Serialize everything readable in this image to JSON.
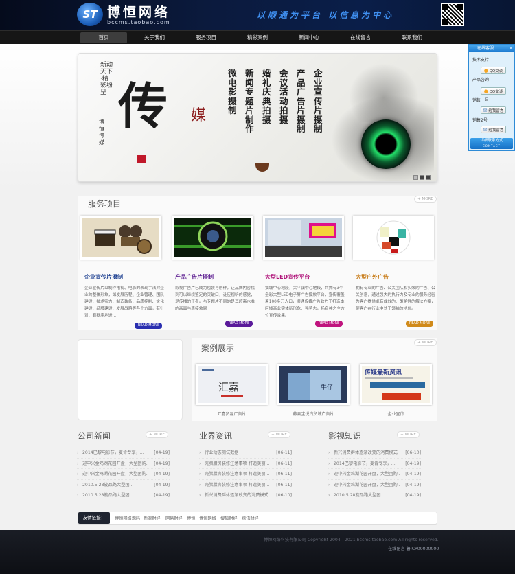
{
  "header": {
    "logo_mark": "ST",
    "logo_text": "博恒网络",
    "logo_domain": "bccms.taobao.com",
    "slogan": "以顺通为平台  以信息为中心"
  },
  "nav": [
    "首页",
    "关于我们",
    "服务项目",
    "精彩案例",
    "新闻中心",
    "在线留言",
    "联系我们"
  ],
  "banner": {
    "calligraphy_1": "新动天下·精彩纷呈",
    "calligraphy_2": "博恒传媒",
    "big_char": "传",
    "media_char": "媒",
    "columns": [
      "微电影摄制",
      "新闻专题片制作",
      "婚礼庆典拍摄",
      "会议活动拍摄",
      "产品广告片摄制",
      "企业宣传片摄制"
    ]
  },
  "qq": {
    "title": "在线客服",
    "close": "×",
    "groups": [
      {
        "label": "技术支持",
        "button": "QQ交谈"
      },
      {
        "label": "产品咨询",
        "button": "QQ交谈"
      },
      {
        "label": "销售一号",
        "button": "给我留言"
      },
      {
        "label": "销售2号",
        "button": "给我留言"
      }
    ],
    "footer": "详细联系方式",
    "footer_sub": "CONTACT"
  },
  "services": {
    "title": "服务项目",
    "more": "+ MORE",
    "items": [
      {
        "title": "企业宣传片摄制",
        "color": "#1a3d8f",
        "text": "企业宣传片以制作电视、电影的表现手法对企业的整体形象，如发展历程、企业管理、团队建设、技术实力、制造装备、品质控制、文化建设、品牌建设、发展战略等各个方面，有针对、有秩序地进...",
        "more": "READ MORE",
        "btn_color": "#2a2fb0"
      },
      {
        "title": "产品广告片摄制",
        "color": "#5a1a8f",
        "text": "影视广告片已成为包装与创作，让品牌内容找到可以继续鉴定的突破口，让应视听的感觉，是传播的王者。与专题片不同的是其超高水准的画面与表接效果",
        "more": "READ MORE",
        "btn_color": "#5a1a9a"
      },
      {
        "title": "大型LED宣传平台",
        "color": "#b0147a",
        "text": "猫城中心地段，太平镇中心地段，共拥有3个全彩大型LED电子屏广告投放平台，宣传覆盖着100多万人口，顺通传媒广告致力于打造本区域商业实体新形象、强势志，扬名神之全方位宣传效果。",
        "more": "READ MORE",
        "btn_color": "#c0147e"
      },
      {
        "title": "大型户外广告",
        "color": "#c77a14",
        "text": "拥有专业的广告、公关团队和实效的广告、公关创意，通过强大的执行力及专业的服务经验为客户提供卓有成效的、策略性的解决方案，使客户在行业中处于领袖的地位。",
        "more": "READ MORE",
        "btn_color": "#d08a1a"
      }
    ]
  },
  "cases": {
    "title": "案例展示",
    "more": "+ MORE",
    "items": [
      {
        "caption": "汇嘉贸易广告片",
        "img_text": "汇嘉"
      },
      {
        "caption": "藤县宝悦汽贸城广告片",
        "img_text": "牛仔"
      },
      {
        "caption": "企业宣传",
        "img_text": "传媒最新资讯"
      }
    ]
  },
  "news": [
    {
      "title": "公司新闻",
      "more": "+ MORE",
      "rows": [
        {
          "text": "2014巴黎电影节，麦肯专享，...",
          "date": "[04-19]"
        },
        {
          "text": "迎中兴金鸡湖花园开盘，大型团购...",
          "date": "[04-19]"
        },
        {
          "text": "迎中兴金鸡湖花园开盘，大型团购...",
          "date": "[04-19]"
        },
        {
          "text": "2010.5.28旋品路大型团...",
          "date": "[04-19]"
        },
        {
          "text": "2010.5.28旋品路大型团...",
          "date": "[04-19]"
        }
      ]
    },
    {
      "title": "业界资讯",
      "more": "+ MORE",
      "rows": [
        {
          "text": "行业动态测试数据",
          "date": "[06-11]"
        },
        {
          "text": "壳腊腊房装修注意事项 打造美丽...",
          "date": "[06-11]"
        },
        {
          "text": "壳腊腊房装修注意事项 打造美丽...",
          "date": "[06-11]"
        },
        {
          "text": "壳腊腊房装修注意事项 打造美丽...",
          "date": "[06-11]"
        },
        {
          "text": "新兴消费群体逐渐改变的消费模式",
          "date": "[06-10]"
        }
      ]
    },
    {
      "title": "影视知识",
      "more": "+ MORE",
      "rows": [
        {
          "text": "新兴消费群体逐渐改变的消费模式",
          "date": "[06-10]"
        },
        {
          "text": "2014巴黎电影节，麦肯专享，...",
          "date": "[04-19]"
        },
        {
          "text": "迎中兴金鸡湖花园开盘，大型团购...",
          "date": "[04-19]"
        },
        {
          "text": "迎中兴金鸡湖花园开盘，大型团购...",
          "date": "[04-19]"
        },
        {
          "text": "2010.5.28旋品路大型团...",
          "date": "[04-19]"
        }
      ]
    }
  ],
  "links": {
    "label": "友情链接：",
    "items": [
      "博恒网络源码",
      "新浪财经",
      "网易财经",
      "博恒",
      "博恒网络",
      "搜狐财经",
      "腾讯财经"
    ]
  },
  "footer": {
    "copyright": "博恒网络科技有限公司 Copyright 2004 - 2021 bccms.taobao.com All rights reserved.",
    "icp": "在线留言  鲁ICP00000000"
  }
}
